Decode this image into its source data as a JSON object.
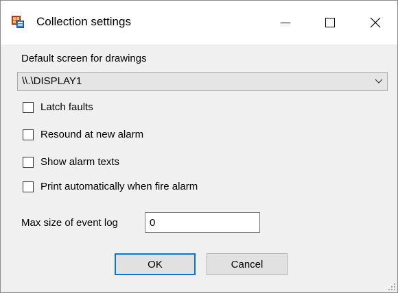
{
  "window": {
    "title": "Collection settings",
    "icon": "app-settings-icon"
  },
  "caption_buttons": {
    "minimize": "minimize-icon",
    "maximize": "maximize-icon",
    "close": "close-icon"
  },
  "default_screen": {
    "label": "Default screen for drawings",
    "selected": "\\\\.\\DISPLAY1"
  },
  "options": [
    {
      "label": "Latch faults",
      "checked": false
    },
    {
      "label": "Resound at new alarm",
      "checked": false
    },
    {
      "label": "Show alarm texts",
      "checked": false
    },
    {
      "label": "Print automatically when fire alarm",
      "checked": false
    }
  ],
  "event_log": {
    "label": "Max size of event log",
    "value": "0"
  },
  "buttons": {
    "ok": "OK",
    "cancel": "Cancel"
  },
  "colors": {
    "accent": "#0078d7",
    "dialog_background": "#f0f0f0"
  }
}
